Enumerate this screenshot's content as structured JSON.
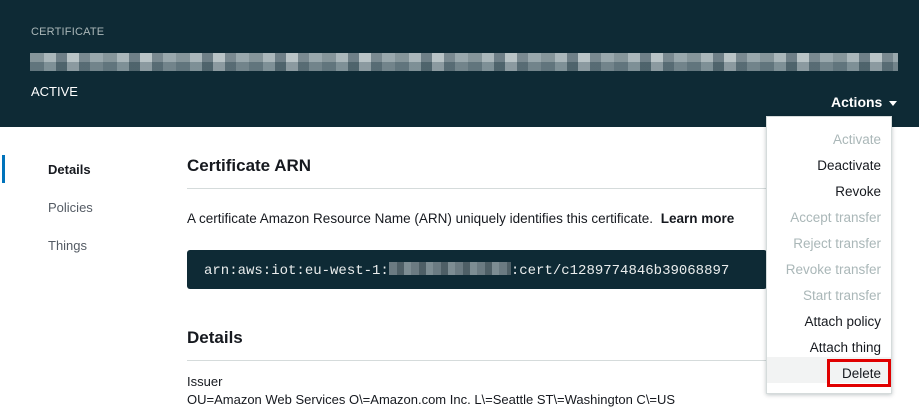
{
  "header": {
    "section_label": "CERTIFICATE",
    "status": "ACTIVE",
    "actions_label": "Actions"
  },
  "sidebar": {
    "items": [
      {
        "label": "Details",
        "active": true
      },
      {
        "label": "Policies",
        "active": false
      },
      {
        "label": "Things",
        "active": false
      }
    ]
  },
  "main": {
    "arn_heading": "Certificate ARN",
    "arn_description": "A certificate Amazon Resource Name (ARN) uniquely identifies this certificate.",
    "learn_more": "Learn more",
    "arn_prefix": "arn:aws:iot:eu-west-1:",
    "arn_suffix": ":cert/c1289774846b39068897",
    "details_heading": "Details",
    "issuer_label": "Issuer",
    "issuer_value": "OU=Amazon Web Services O\\=Amazon.com Inc. L\\=Seattle ST\\=Washington C\\=US"
  },
  "actions_menu": {
    "items": [
      {
        "label": "Activate",
        "enabled": false
      },
      {
        "label": "Deactivate",
        "enabled": true
      },
      {
        "label": "Revoke",
        "enabled": true
      },
      {
        "label": "Accept transfer",
        "enabled": false
      },
      {
        "label": "Reject transfer",
        "enabled": false
      },
      {
        "label": "Revoke transfer",
        "enabled": false
      },
      {
        "label": "Start transfer",
        "enabled": false
      },
      {
        "label": "Attach policy",
        "enabled": true
      },
      {
        "label": "Attach thing",
        "enabled": true
      },
      {
        "label": "Delete",
        "enabled": true,
        "highlighted": true
      }
    ]
  },
  "colors": {
    "header_bg": "#0e2a35",
    "accent": "#0073bb",
    "disabled_text": "#aab7b8",
    "highlight_border": "#e00000"
  }
}
